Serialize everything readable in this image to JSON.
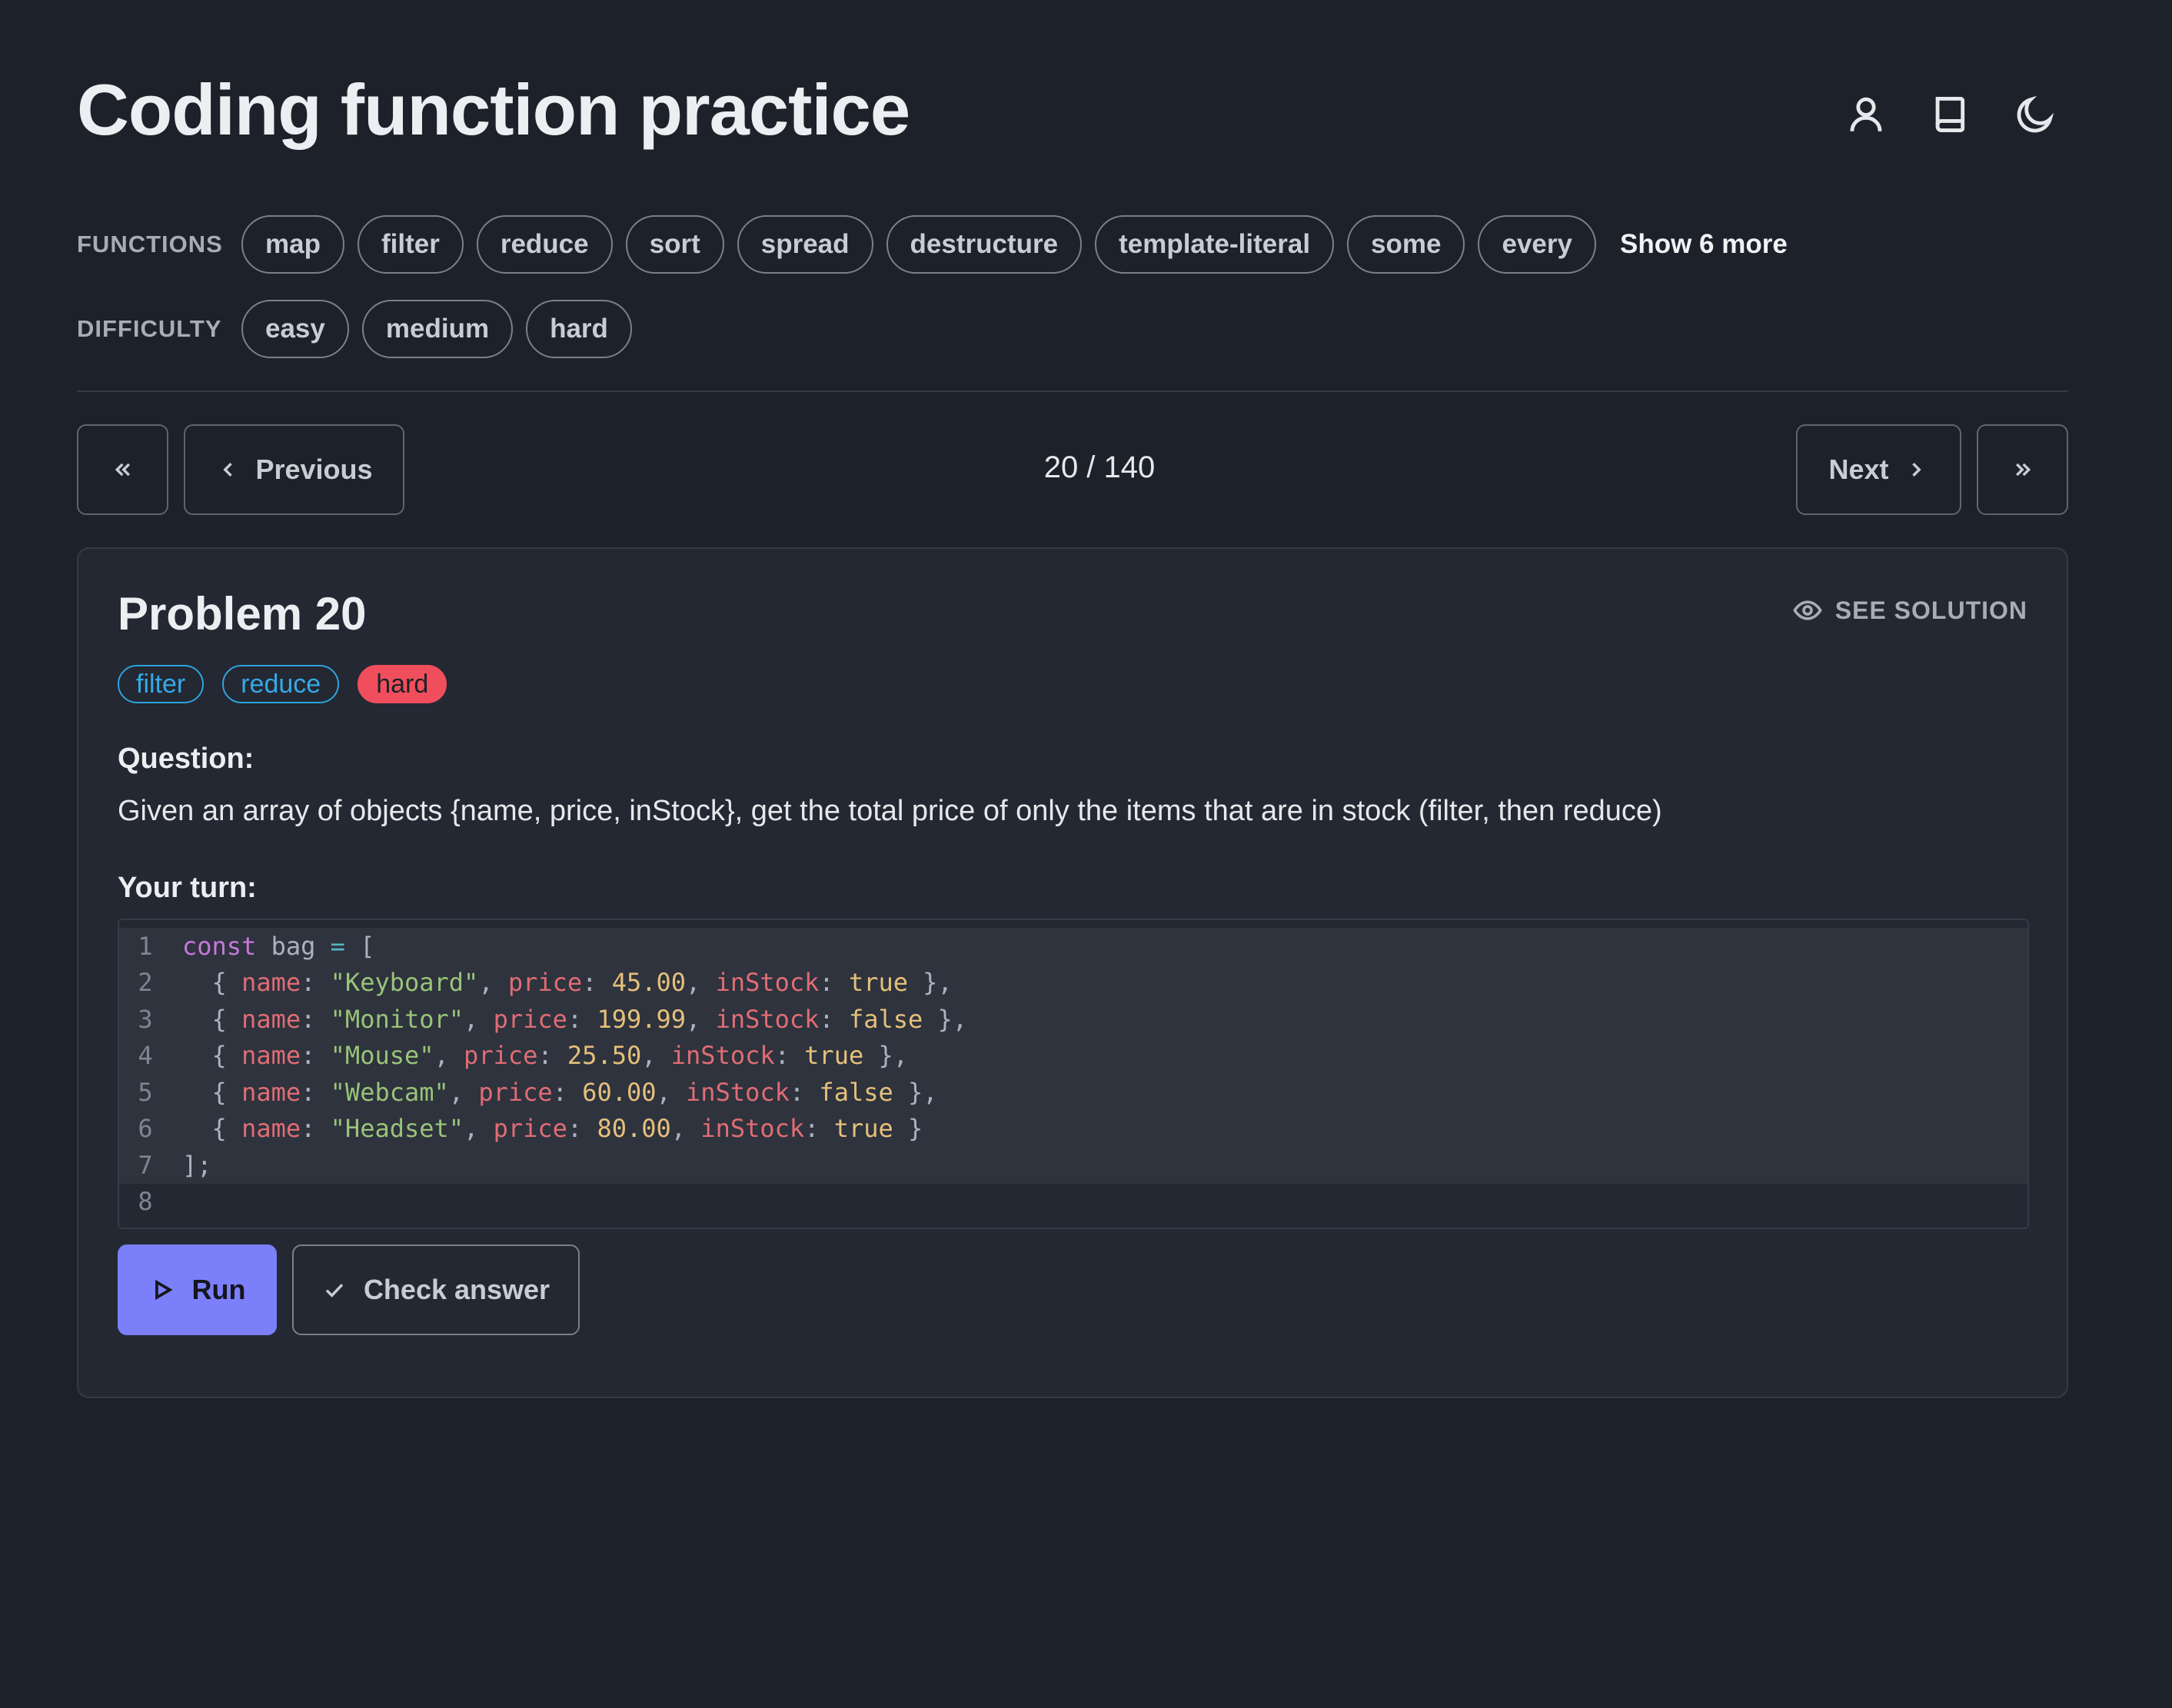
{
  "header": {
    "title": "Coding function practice",
    "icons": [
      "user-icon",
      "book-icon",
      "moon-icon"
    ]
  },
  "filters": {
    "functions_label": "FUNCTIONS",
    "functions": [
      "map",
      "filter",
      "reduce",
      "sort",
      "spread",
      "destructure",
      "template-literal",
      "some",
      "every"
    ],
    "show_more": "Show 6 more",
    "difficulty_label": "DIFFICULTY",
    "difficulties": [
      "easy",
      "medium",
      "hard"
    ]
  },
  "nav": {
    "first_icon": "double-chevron-left-icon",
    "previous_label": "Previous",
    "pager": "20 / 140",
    "next_label": "Next",
    "last_icon": "double-chevron-right-icon"
  },
  "problem": {
    "title": "Problem 20",
    "see_solution": "SEE SOLUTION",
    "tags": [
      "filter",
      "reduce"
    ],
    "difficulty": "hard",
    "question_label": "Question:",
    "question": "Given an array of objects {name, price, inStock}, get the total price of only the items that are in stock (filter, then reduce)",
    "your_turn_label": "Your turn:",
    "code_lines": [
      "const bag = [",
      "  { name: \"Keyboard\", price: 45.00, inStock: true },",
      "  { name: \"Monitor\", price: 199.99, inStock: false },",
      "  { name: \"Mouse\", price: 25.50, inStock: true },",
      "  { name: \"Webcam\", price: 60.00, inStock: false },",
      "  { name: \"Headset\", price: 80.00, inStock: true }",
      "];",
      ""
    ],
    "run_label": "Run",
    "check_label": "Check answer"
  },
  "colors": {
    "background": "#1d2129",
    "card": "#232832",
    "accent": "#7b7ffa",
    "tag_blue": "#35a9e8",
    "hard_red": "#f04e5c"
  }
}
